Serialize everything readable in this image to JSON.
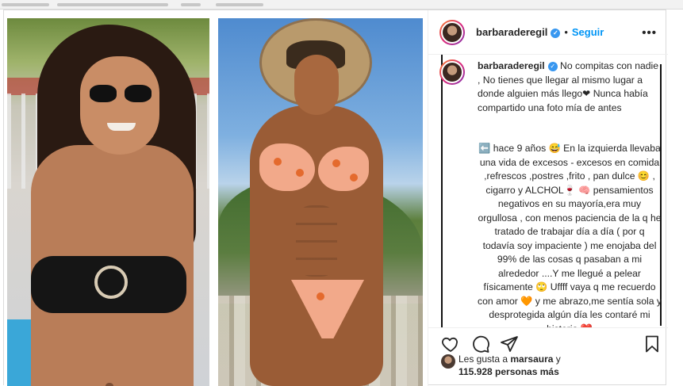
{
  "post": {
    "username": "barbaraderegil",
    "follow_label": "Seguir",
    "more_label": "•••",
    "separator": "•",
    "verified_mark": "✓",
    "caption": {
      "username": "barbaraderegil",
      "paragraph1": " No compitas con nadie , No tienes que llegar al mismo lugar a donde alguien más llego❤ Nunca había compartido una foto mía de antes",
      "paragraph2": "⬅️ hace 9 años 😅 En la izquierda llevaba una vida de excesos - excesos en comida ,refrescos ,postres ,frito , pan dulce 😊 , cigarro y ALCHOL🍷 🧠 pensamientos negativos en su mayoría,era muy orgullosa , con menos paciencia de la q he tratado de trabajar día a día ( por q todavía soy impaciente ) me enojaba del 99% de las cosas q pasaban a mi alrededor ....Y me llegué a pelear físicamente 🙄 Uffff vaya q me recuerdo con amor 🧡 y me abrazo,me sentía sola y desprotegida algún día les contaré mi historia ❤️"
    },
    "icons": {
      "like": "heart-icon",
      "comment": "comment-icon",
      "share": "paper-plane-icon",
      "save": "bookmark-icon",
      "more": "more-options-icon",
      "verified": "verified-badge-icon"
    },
    "likes": {
      "prefix": "Les gusta a ",
      "user": "marsaura",
      "middle": " y ",
      "count": "115.928 personas más"
    }
  },
  "colors": {
    "accent": "#0095f6",
    "verified": "#3897f0",
    "text": "#262626",
    "border": "#dbdbdb"
  }
}
